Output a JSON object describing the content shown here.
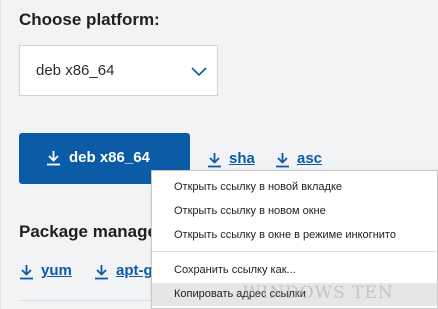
{
  "platform": {
    "heading": "Choose platform:",
    "selected": "deb x86_64"
  },
  "download": {
    "button_label": "deb x86_64",
    "links": [
      "sha",
      "asc"
    ]
  },
  "package_managers": {
    "heading": "Package managers",
    "links": [
      "yum",
      "apt-get"
    ]
  },
  "context_menu": {
    "items": [
      "Открыть ссылку в новой вкладке",
      "Открыть ссылку в новом окне",
      "Открыть ссылку в окне в режиме инкогнито",
      "Сохранить ссылку как...",
      "Копировать адрес ссылки"
    ]
  },
  "watermark": "WINDOWS TEN",
  "colors": {
    "accent": "#0c5ba7",
    "background": "#f2f3f4",
    "menu_highlight": "#e6e6e6"
  }
}
